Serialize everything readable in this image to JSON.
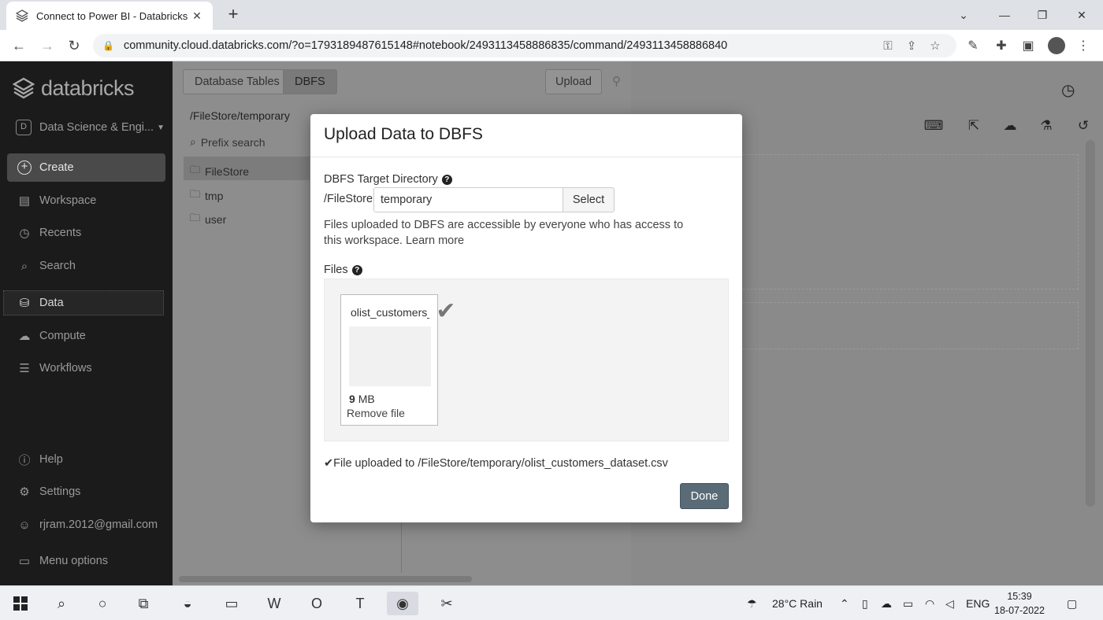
{
  "browser": {
    "tab_title": "Connect to Power BI - Databricks",
    "new_tab": "+",
    "url": "community.cloud.databricks.com/?o=1793189487615148#notebook/2493113458886835/command/2493113458886840"
  },
  "sidebar": {
    "brand": "databricks",
    "persona_letter": "D",
    "persona": "Data Science & Engi...",
    "create": "Create",
    "items": [
      {
        "label": "Workspace"
      },
      {
        "label": "Recents"
      },
      {
        "label": "Search"
      },
      {
        "label": "Data"
      },
      {
        "label": "Compute"
      },
      {
        "label": "Workflows"
      }
    ],
    "bottom": [
      {
        "label": "Help"
      },
      {
        "label": "Settings"
      },
      {
        "label": "rjram.2012@gmail.com"
      },
      {
        "label": "Menu options"
      }
    ]
  },
  "file_panel": {
    "tab_tables": "Database Tables",
    "tab_dbfs": "DBFS",
    "upload": "Upload",
    "path": "/FileStore/temporary",
    "prefix_search": "Prefix search",
    "folders": [
      "FileStore",
      "tmp",
      "user"
    ]
  },
  "modal": {
    "title": "Upload Data to DBFS",
    "target_label": "DBFS Target Directory",
    "prefix": "/FileStore",
    "dir_value": "temporary",
    "select": "Select",
    "note": "Files uploaded to DBFS are accessible by everyone who has access to this workspace.",
    "learn_more": "Learn more",
    "files_label": "Files",
    "file": {
      "name": "olist_customers_dataset.csv",
      "size_num": "9",
      "size_unit": "MB",
      "remove": "Remove file"
    },
    "success": "File uploaded to /FileStore/temporary/olist_customers_dataset.csv",
    "done": "Done"
  },
  "taskbar": {
    "weather": "28°C  Rain",
    "lang": "ENG",
    "time": "15:39",
    "date": "18-07-2022"
  }
}
